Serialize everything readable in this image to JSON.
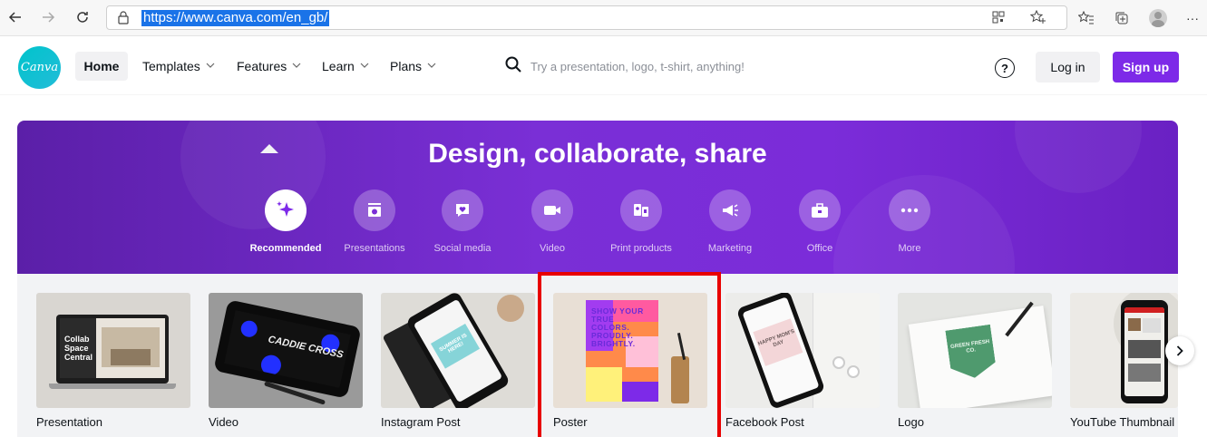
{
  "browser": {
    "url": "https://www.canva.com/en_gb/",
    "back_icon": "arrow-left-icon",
    "forward_icon": "arrow-right-icon",
    "reload_icon": "reload-icon",
    "lock_icon": "lock-icon",
    "more_label": "···"
  },
  "header": {
    "logo_text": "Canva",
    "nav": {
      "home": "Home",
      "templates": "Templates",
      "features": "Features",
      "learn": "Learn",
      "plans": "Plans"
    },
    "search_placeholder": "Try a presentation, logo, t-shirt, anything!",
    "help_label": "?",
    "login": "Log in",
    "signup": "Sign up"
  },
  "hero": {
    "title": "Design, collaborate, share",
    "categories": [
      {
        "label": "Recommended",
        "icon": "sparkle-icon",
        "active": true
      },
      {
        "label": "Presentations",
        "icon": "presentation-icon",
        "active": false
      },
      {
        "label": "Social media",
        "icon": "heart-chat-icon",
        "active": false
      },
      {
        "label": "Video",
        "icon": "video-camera-icon",
        "active": false
      },
      {
        "label": "Print products",
        "icon": "print-icon",
        "active": false
      },
      {
        "label": "Marketing",
        "icon": "megaphone-icon",
        "active": false
      },
      {
        "label": "Office",
        "icon": "briefcase-icon",
        "active": false
      },
      {
        "label": "More",
        "icon": "more-dots-icon",
        "active": false
      }
    ]
  },
  "cards": [
    {
      "label": "Presentation"
    },
    {
      "label": "Video",
      "thumb_text": "CADDIE CROSS"
    },
    {
      "label": "Instagram Post",
      "thumb_text": "SUMMER IS HERE!"
    },
    {
      "label": "Poster",
      "thumb_text": "SHOW YOUR TRUE COLORS. PROUDLY. BRIGHTLY."
    },
    {
      "label": "Facebook Post",
      "thumb_text": "HAPPY MOM'S DAY"
    },
    {
      "label": "Logo",
      "thumb_text": "GREEN FRESH CO."
    },
    {
      "label": "YouTube Thumbnail"
    }
  ],
  "presentation_thumb": {
    "line1": "Collab",
    "line2": "Space",
    "line3": "Central"
  },
  "colors": {
    "brand": "#7d2ae8",
    "logo": "#00c4cc",
    "highlight": "#e80000"
  }
}
